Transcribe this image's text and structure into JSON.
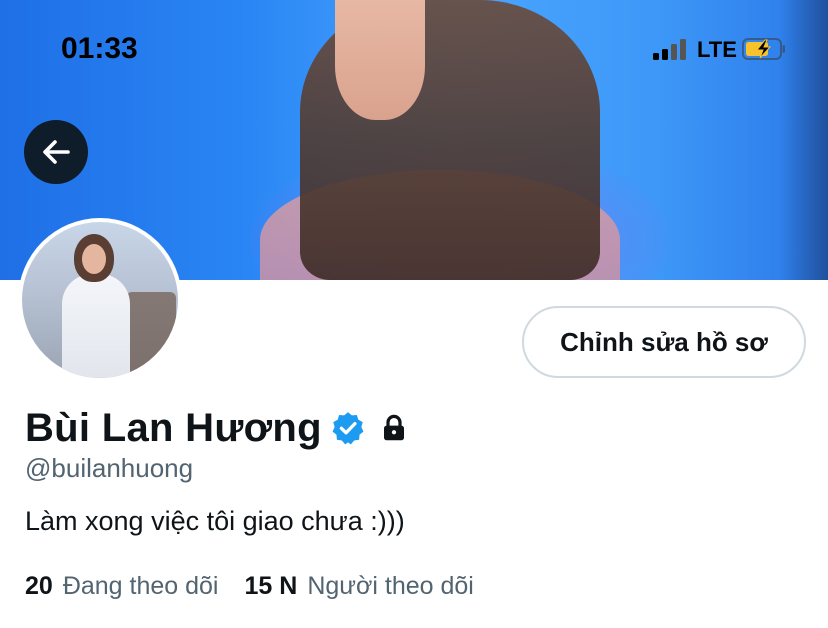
{
  "status_bar": {
    "time": "01:33",
    "network": "LTE",
    "battery_state": "charging",
    "battery_color": "#f7c22c"
  },
  "banner": {
    "icon_back": "arrow-left-icon"
  },
  "profile": {
    "edit_button_label": "Chỉnh sửa hồ sơ",
    "name": "Bùi Lan Hương",
    "handle": "@builanhuong",
    "bio": "Làm xong việc tôi giao chưa :)))",
    "verified": true,
    "protected": true,
    "verified_color": "#1d9bf0"
  },
  "stats": {
    "following_count": "20",
    "following_label": "Đang theo dõi",
    "followers_count": "15 N",
    "followers_label": "Người theo dõi"
  }
}
